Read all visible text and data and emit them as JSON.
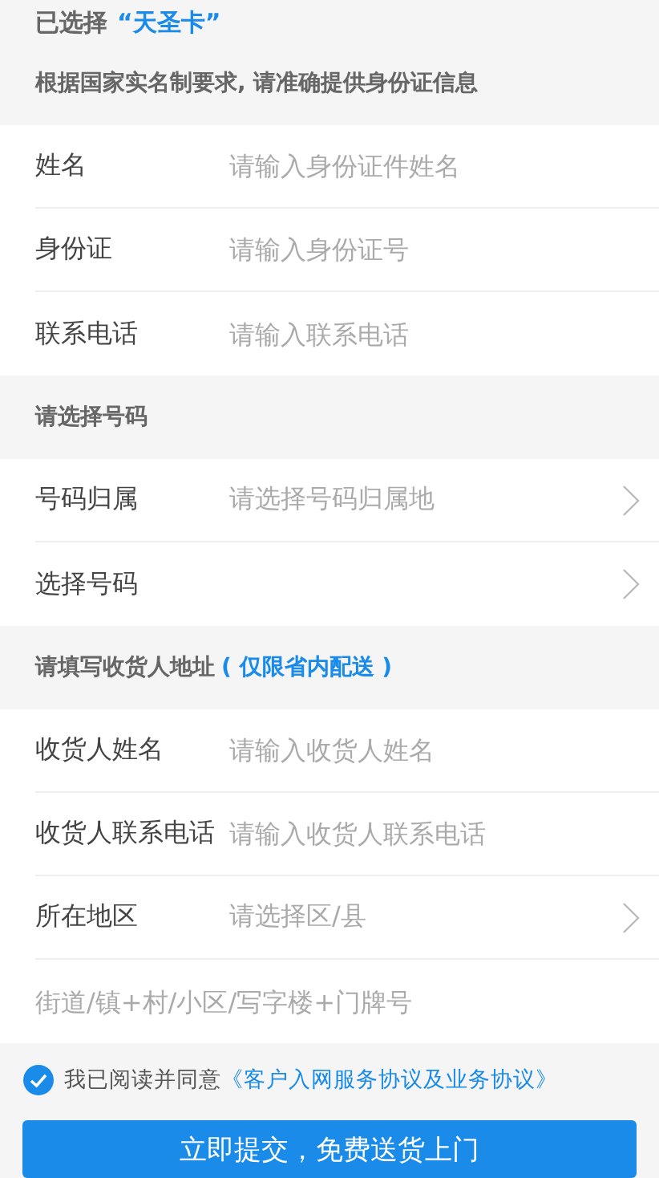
{
  "header": {
    "title": "已选择",
    "card_name": "“天圣卡”",
    "notice": "根据国家实名制要求, 请准确提供身份证信息"
  },
  "sections": [
    {
      "fields": [
        {
          "kind": "input",
          "label": "姓名",
          "placeholder": "请输入身份证件姓名"
        },
        {
          "kind": "input",
          "label": "身份证",
          "placeholder": "请输入身份证号"
        },
        {
          "kind": "input",
          "label": "联系电话",
          "placeholder": "请输入联系电话"
        }
      ]
    },
    {
      "heading": "请选择号码",
      "fields": [
        {
          "kind": "select",
          "label": "号码归属",
          "placeholder": "请选择号码归属地"
        },
        {
          "kind": "select",
          "label": "选择号码"
        }
      ]
    },
    {
      "heading": "请填写收货人地址",
      "heading_note": "( 仅限省内配送 )",
      "fields": [
        {
          "kind": "input",
          "label": "收货人姓名",
          "placeholder": "请输入收货人姓名"
        },
        {
          "kind": "input",
          "label": "收货人联系电话",
          "placeholder": "请输入收货人联系电话"
        },
        {
          "kind": "select",
          "label": "所在地区",
          "placeholder": "请选择区/县"
        },
        {
          "kind": "input",
          "placeholder": "街道/镇+村/小区/写字楼+门牌号"
        }
      ]
    }
  ],
  "agreement": {
    "checked": true,
    "text": "我已阅读并同意",
    "link": "《客户入网服务协议及业务协议》"
  },
  "submit_button": "立即提交，免费送货上门"
}
